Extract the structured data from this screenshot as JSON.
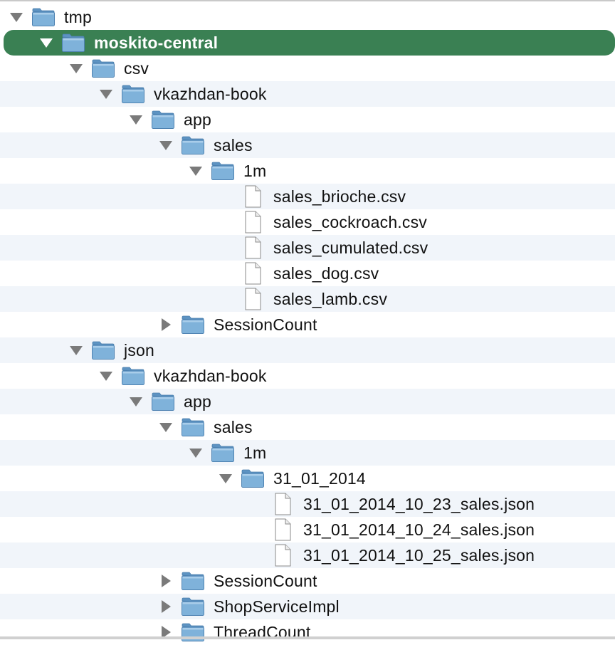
{
  "tree": {
    "rows": [
      {
        "label": "tmp",
        "level": 0,
        "type": "folder",
        "expanded": true,
        "selected": false
      },
      {
        "label": "moskito-central",
        "level": 1,
        "type": "folder",
        "expanded": true,
        "selected": true
      },
      {
        "label": "csv",
        "level": 2,
        "type": "folder",
        "expanded": true,
        "selected": false
      },
      {
        "label": "vkazhdan-book",
        "level": 3,
        "type": "folder",
        "expanded": true,
        "selected": false
      },
      {
        "label": "app",
        "level": 4,
        "type": "folder",
        "expanded": true,
        "selected": false
      },
      {
        "label": "sales",
        "level": 5,
        "type": "folder",
        "expanded": true,
        "selected": false
      },
      {
        "label": "1m",
        "level": 6,
        "type": "folder",
        "expanded": true,
        "selected": false
      },
      {
        "label": "sales_brioche.csv",
        "level": 7,
        "type": "file",
        "selected": false
      },
      {
        "label": "sales_cockroach.csv",
        "level": 7,
        "type": "file",
        "selected": false
      },
      {
        "label": "sales_cumulated.csv",
        "level": 7,
        "type": "file",
        "selected": false
      },
      {
        "label": "sales_dog.csv",
        "level": 7,
        "type": "file",
        "selected": false
      },
      {
        "label": "sales_lamb.csv",
        "level": 7,
        "type": "file",
        "selected": false
      },
      {
        "label": "SessionCount",
        "level": 5,
        "type": "folder",
        "expanded": false,
        "selected": false
      },
      {
        "label": "json",
        "level": 2,
        "type": "folder",
        "expanded": true,
        "selected": false
      },
      {
        "label": "vkazhdan-book",
        "level": 3,
        "type": "folder",
        "expanded": true,
        "selected": false
      },
      {
        "label": "app",
        "level": 4,
        "type": "folder",
        "expanded": true,
        "selected": false
      },
      {
        "label": "sales",
        "level": 5,
        "type": "folder",
        "expanded": true,
        "selected": false
      },
      {
        "label": "1m",
        "level": 6,
        "type": "folder",
        "expanded": true,
        "selected": false
      },
      {
        "label": "31_01_2014",
        "level": 7,
        "type": "folder",
        "expanded": true,
        "selected": false
      },
      {
        "label": "31_01_2014_10_23_sales.json",
        "level": 8,
        "type": "file",
        "selected": false
      },
      {
        "label": "31_01_2014_10_24_sales.json",
        "level": 8,
        "type": "file",
        "selected": false
      },
      {
        "label": "31_01_2014_10_25_sales.json",
        "level": 8,
        "type": "file",
        "selected": false
      },
      {
        "label": "SessionCount",
        "level": 5,
        "type": "folder",
        "expanded": false,
        "selected": false
      },
      {
        "label": "ShopServiceImpl",
        "level": 5,
        "type": "folder",
        "expanded": false,
        "selected": false
      },
      {
        "label": "ThreadCount",
        "level": 5,
        "type": "folder",
        "expanded": false,
        "selected": false
      }
    ]
  },
  "colors": {
    "selection": "#3a8053",
    "stripe": "#f1f5fa",
    "folder": "#7fb2da",
    "disclosure": "#7a7a7a"
  },
  "icons": {
    "folder": "folder-icon",
    "file": "file-icon",
    "expanded": "triangle-down-icon",
    "collapsed": "triangle-right-icon"
  }
}
